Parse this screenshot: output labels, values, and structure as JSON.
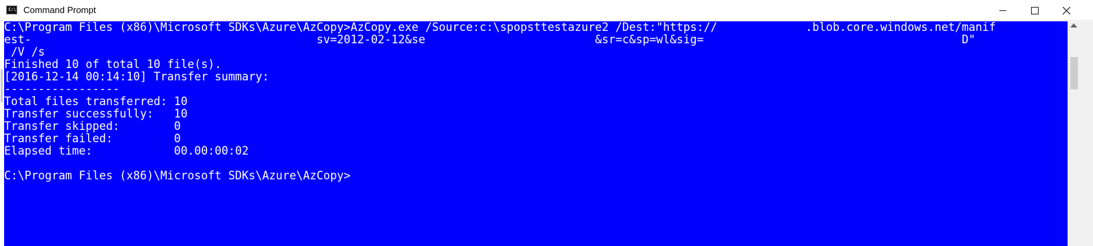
{
  "window": {
    "title": "Command Prompt",
    "icon": "cmd-icon",
    "icon_text": "C:\\",
    "controls": [
      "minimize",
      "maximize",
      "close"
    ]
  },
  "console": {
    "background": "#0000fd",
    "foreground": "#ffffff",
    "lines": [
      "C:\\Program Files (x86)\\Microsoft SDKs\\Azure\\AzCopy>AzCopy.exe /Source:c:\\spopsttestazure2 /Dest:\"https://             .blob.core.windows.net/manif",
      "est-                                          sv=2012-02-12&se                         &sr=c&sp=wl&sig=                                      D\"",
      " /V /s",
      "Finished 10 of total 10 file(s).",
      "[2016-12-14 00:14:10] Transfer summary:",
      "-----------------",
      "Total files transferred: 10",
      "Transfer successfully:   10",
      "Transfer skipped:        0",
      "Transfer failed:         0",
      "Elapsed time:            00.00:00:02",
      "",
      "C:\\Program Files (x86)\\Microsoft SDKs\\Azure\\AzCopy>"
    ]
  },
  "scrollbar": {
    "up_arrow": "scroll-up-arrow-icon"
  }
}
